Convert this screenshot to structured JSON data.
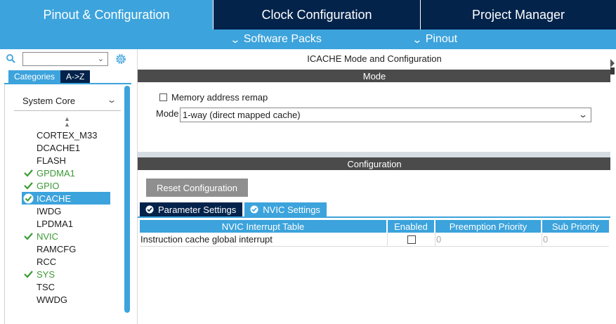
{
  "top_tabs": [
    {
      "label": "Pinout & Configuration"
    },
    {
      "label": "Clock Configuration"
    },
    {
      "label": "Project Manager"
    }
  ],
  "sub_menu": {
    "software_packs": "Software Packs",
    "pinout": "Pinout"
  },
  "left": {
    "category_tabs": [
      "Categories",
      "A->Z"
    ],
    "group": "System Core",
    "items": [
      {
        "label": "CORTEX_M33",
        "status": "none"
      },
      {
        "label": "DCACHE1",
        "status": "none"
      },
      {
        "label": "FLASH",
        "status": "none"
      },
      {
        "label": "GPDMA1",
        "status": "ok"
      },
      {
        "label": "GPIO",
        "status": "ok"
      },
      {
        "label": "ICACHE",
        "status": "selected"
      },
      {
        "label": "IWDG",
        "status": "none"
      },
      {
        "label": "LPDMA1",
        "status": "none"
      },
      {
        "label": "NVIC",
        "status": "ok"
      },
      {
        "label": "RAMCFG",
        "status": "none"
      },
      {
        "label": "RCC",
        "status": "none"
      },
      {
        "label": "SYS",
        "status": "ok"
      },
      {
        "label": "TSC",
        "status": "none"
      },
      {
        "label": "WWDG",
        "status": "none"
      }
    ]
  },
  "right": {
    "title": "ICACHE Mode and Configuration",
    "mode_header": "Mode",
    "memory_remap_label": "Memory address remap",
    "mode_label": "Mode",
    "mode_value": "1-way (direct mapped cache)",
    "config_header": "Configuration",
    "reset_button": "Reset Configuration",
    "tabs": [
      {
        "label": "Parameter Settings"
      },
      {
        "label": "NVIC Settings"
      }
    ],
    "table": {
      "headers": [
        "NVIC Interrupt Table",
        "Enabled",
        "Preemption Priority",
        "Sub Priority"
      ],
      "rows": [
        {
          "name": "Instruction cache global interrupt",
          "enabled": false,
          "preemption": "0",
          "sub": "0"
        }
      ]
    }
  },
  "colors": {
    "accent": "#3ca3dc",
    "dark": "#03234b",
    "band": "#4b4b4b",
    "ok": "#3b9a35"
  }
}
